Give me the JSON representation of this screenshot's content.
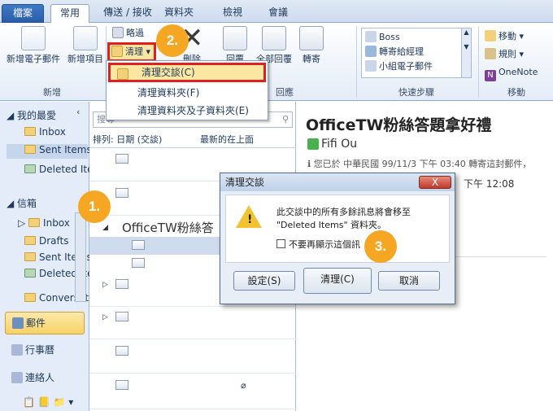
{
  "tabs": [
    "檔案",
    "常用",
    "傳送 / 接收",
    "資料夾",
    "檢視",
    "會議"
  ],
  "ribbon": {
    "new_email": "新增電子郵件",
    "new_items": "新增項目",
    "group_new": "新增",
    "ignore": "略過",
    "cleanup": "清理",
    "delete": "刪除",
    "reply": "回覆",
    "reply_all": "全部回覆",
    "forward": "轉寄",
    "group_respond": "回應",
    "quick_steps": [
      "Boss",
      "轉寄給經理",
      "小組電子郵件"
    ],
    "group_quick": "快速步驟",
    "move": "移動",
    "rules": "規則",
    "onenote": "OneNote",
    "group_move": "移動"
  },
  "menu": {
    "items": [
      "清理交談(C)",
      "清理資料夾(F)",
      "清理資料夾及子資料夾(E)"
    ]
  },
  "nav": {
    "favorites": "我的最愛",
    "fav_items": [
      "Inbox",
      "Sent Items",
      "Deleted Items"
    ],
    "mailbox": "信箱",
    "box_items": [
      "Inbox",
      "Drafts",
      "Sent Items",
      "Deleted Items",
      "Conversation History"
    ],
    "bottom": [
      "郵件",
      "行事曆",
      "連絡人"
    ]
  },
  "list": {
    "search_placeholder": "搜尋",
    "sort_by": "排列: 日期 (交談)",
    "sort_order": "最新的在上面",
    "conversation_subject": "OfficeTW粉絲答"
  },
  "reading": {
    "subject": "OfficeTW粉絲答題拿好禮",
    "sender": "Fifi Ou",
    "info": "您已於 中華民國 99/11/3 下午 03:40 轉寄這封郵件，",
    "time": "下午 12:08"
  },
  "dialog": {
    "title": "清理交談",
    "message_line1": "此交談中的所有多餘訊息將會移至",
    "message_line2": "\"Deleted Items\" 資料夾。",
    "checkbox": "不要再顯示這個訊",
    "settings": "設定(S)",
    "cleanup": "清理(C)",
    "cancel": "取消",
    "close": "X"
  },
  "steps": [
    "1.",
    "2.",
    "3."
  ],
  "colors": {
    "accent": "#f5a623",
    "highlight": "#e02020",
    "file_tab": "#2a5da8"
  }
}
